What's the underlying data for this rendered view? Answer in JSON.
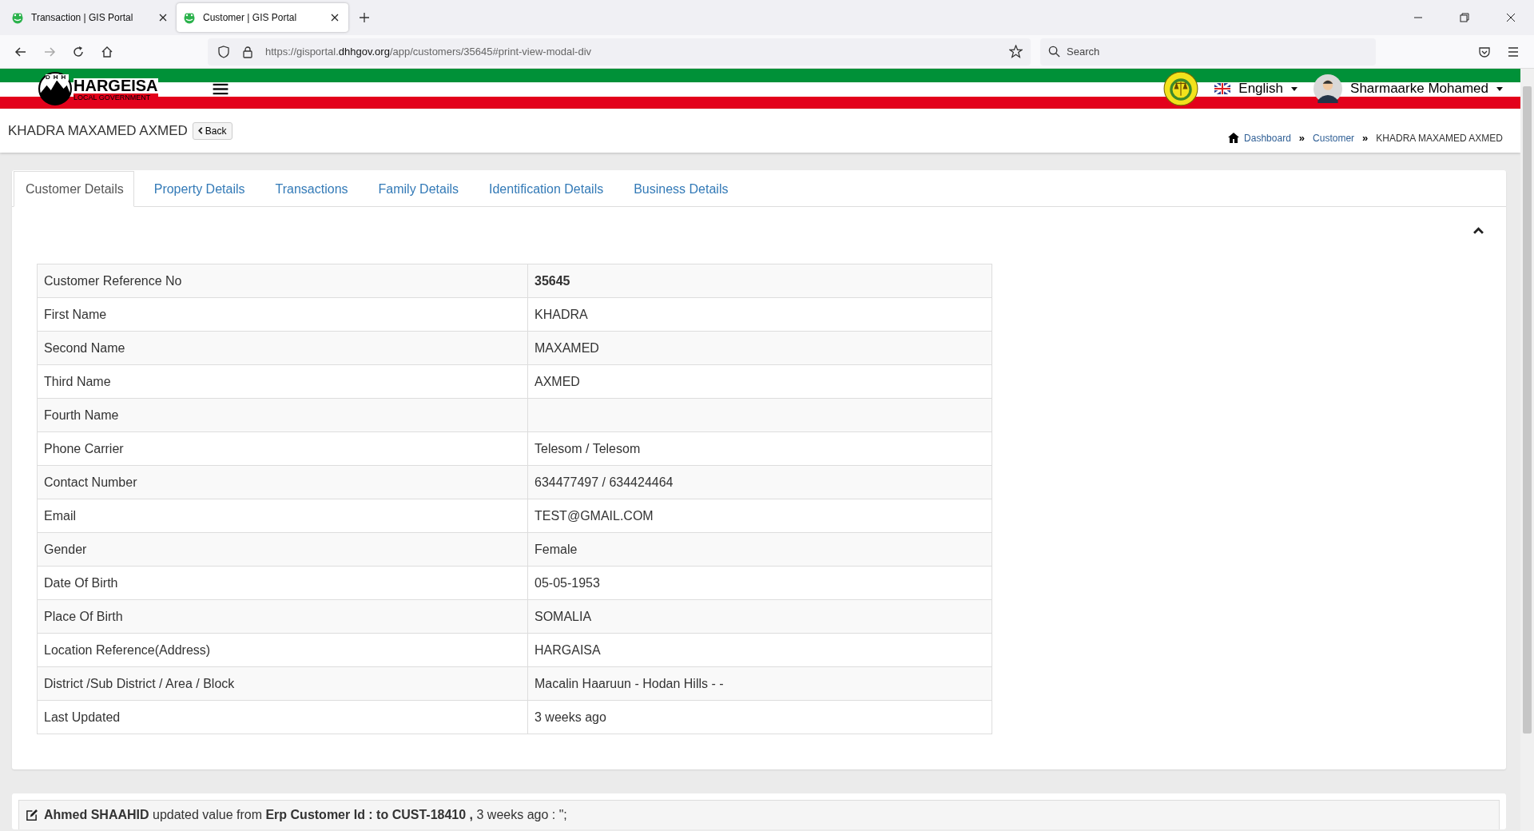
{
  "browser": {
    "tabs": [
      {
        "title": "Transaction | GIS Portal",
        "selected": false
      },
      {
        "title": "Customer | GIS Portal",
        "selected": true
      }
    ],
    "url": {
      "prefix": "https://gisportal.",
      "domain": "dhhgov.org",
      "path": "/app/customers/35645#print-view-modal-div"
    },
    "search": {
      "placeholder": "Search"
    }
  },
  "header": {
    "logo": {
      "mark": "DHH",
      "name": "HARGEISA",
      "subtitle": "LOCAL GOVERNMENT"
    },
    "language": "English",
    "user": "Sharmaarke Mohamed"
  },
  "page": {
    "title": "KHADRA MAXAMED AXMED",
    "back": "Back",
    "breadcrumb": [
      "Dashboard",
      "Customer",
      "KHADRA MAXAMED AXMED"
    ],
    "breadcrumb_separator": "»"
  },
  "tabs": [
    {
      "label": "Customer Details",
      "selected": true
    },
    {
      "label": "Property Details",
      "selected": false
    },
    {
      "label": "Transactions",
      "selected": false
    },
    {
      "label": "Family Details",
      "selected": false
    },
    {
      "label": "Identification Details",
      "selected": false
    },
    {
      "label": "Business Details",
      "selected": false
    }
  ],
  "details": [
    {
      "label": "Customer Reference No",
      "value": "35645",
      "bold": true
    },
    {
      "label": "First Name",
      "value": "KHADRA"
    },
    {
      "label": "Second Name",
      "value": "MAXAMED"
    },
    {
      "label": "Third Name",
      "value": "AXMED"
    },
    {
      "label": "Fourth Name"
    },
    {
      "label": "Phone Carrier",
      "value": "Telesom / Telesom"
    },
    {
      "label": "Contact Number",
      "value": "634477497 / 634424464"
    },
    {
      "label": "Email",
      "value": "TEST@GMAIL.COM"
    },
    {
      "label": "Gender",
      "value": "Female"
    },
    {
      "label": "Date Of Birth",
      "value": "05-05-1953"
    },
    {
      "label": "Place Of Birth",
      "value": "SOMALIA"
    },
    {
      "label": "Location Reference(Address)",
      "value": "HARGAISA"
    },
    {
      "label": "District /Sub District / Area / Block",
      "value": "Macalin Haaruun - Hodan Hills - -"
    },
    {
      "label": "Last Updated",
      "value": "3 weeks ago"
    }
  ],
  "activity": [
    {
      "text": "**Ahmed SHAAHID** updated value from **Erp Customer Id : to CUST-18410 ,** 3 weeks ago : \";"
    }
  ]
}
